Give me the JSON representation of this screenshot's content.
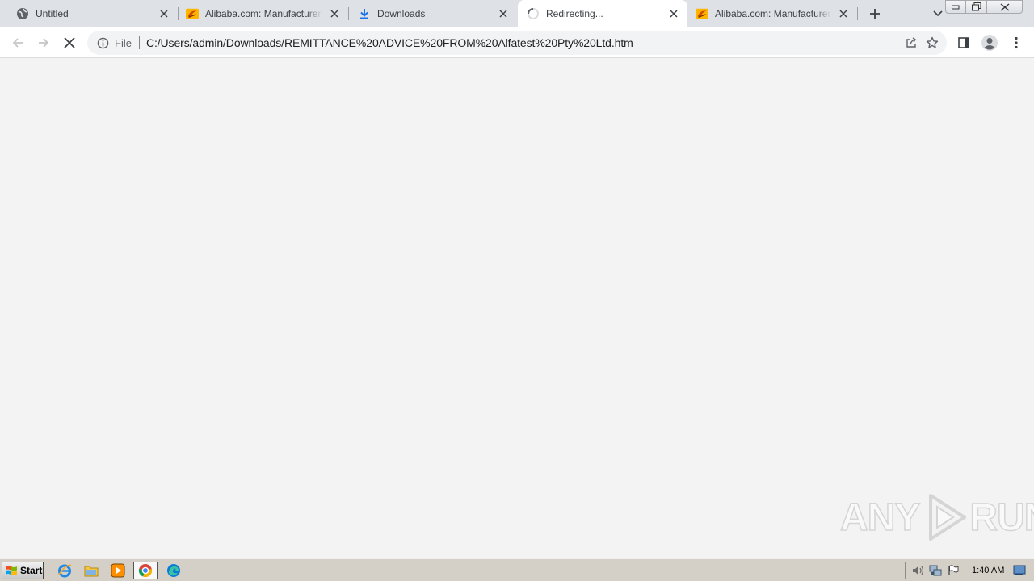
{
  "browser": {
    "tabs": [
      {
        "title": "Untitled",
        "favicon": "globe-icon",
        "active": false
      },
      {
        "title": "Alibaba.com: Manufacturers, Suppliers",
        "favicon": "alibaba-icon",
        "active": false
      },
      {
        "title": "Downloads",
        "favicon": "download-icon",
        "active": false
      },
      {
        "title": "Redirecting...",
        "favicon": "loading-spinner-icon",
        "active": true
      },
      {
        "title": "Alibaba.com: Manufacturers, Suppliers",
        "favicon": "alibaba-icon",
        "active": false
      }
    ],
    "omnibox": {
      "scheme_chip": "File",
      "url": "C:/Users/admin/Downloads/REMITTANCE%20ADVICE%20FROM%20Alfatest%20Pty%20Ltd.htm"
    }
  },
  "watermark": {
    "left": "ANY",
    "right": "RUN"
  },
  "taskbar": {
    "start_label": "Start",
    "clock": "1:40 AM"
  },
  "colors": {
    "tabstrip_bg": "#dee1e6",
    "page_bg": "#f3f3f3",
    "download_blue": "#1a73e8",
    "alibaba_orange": "#ff6a00"
  }
}
